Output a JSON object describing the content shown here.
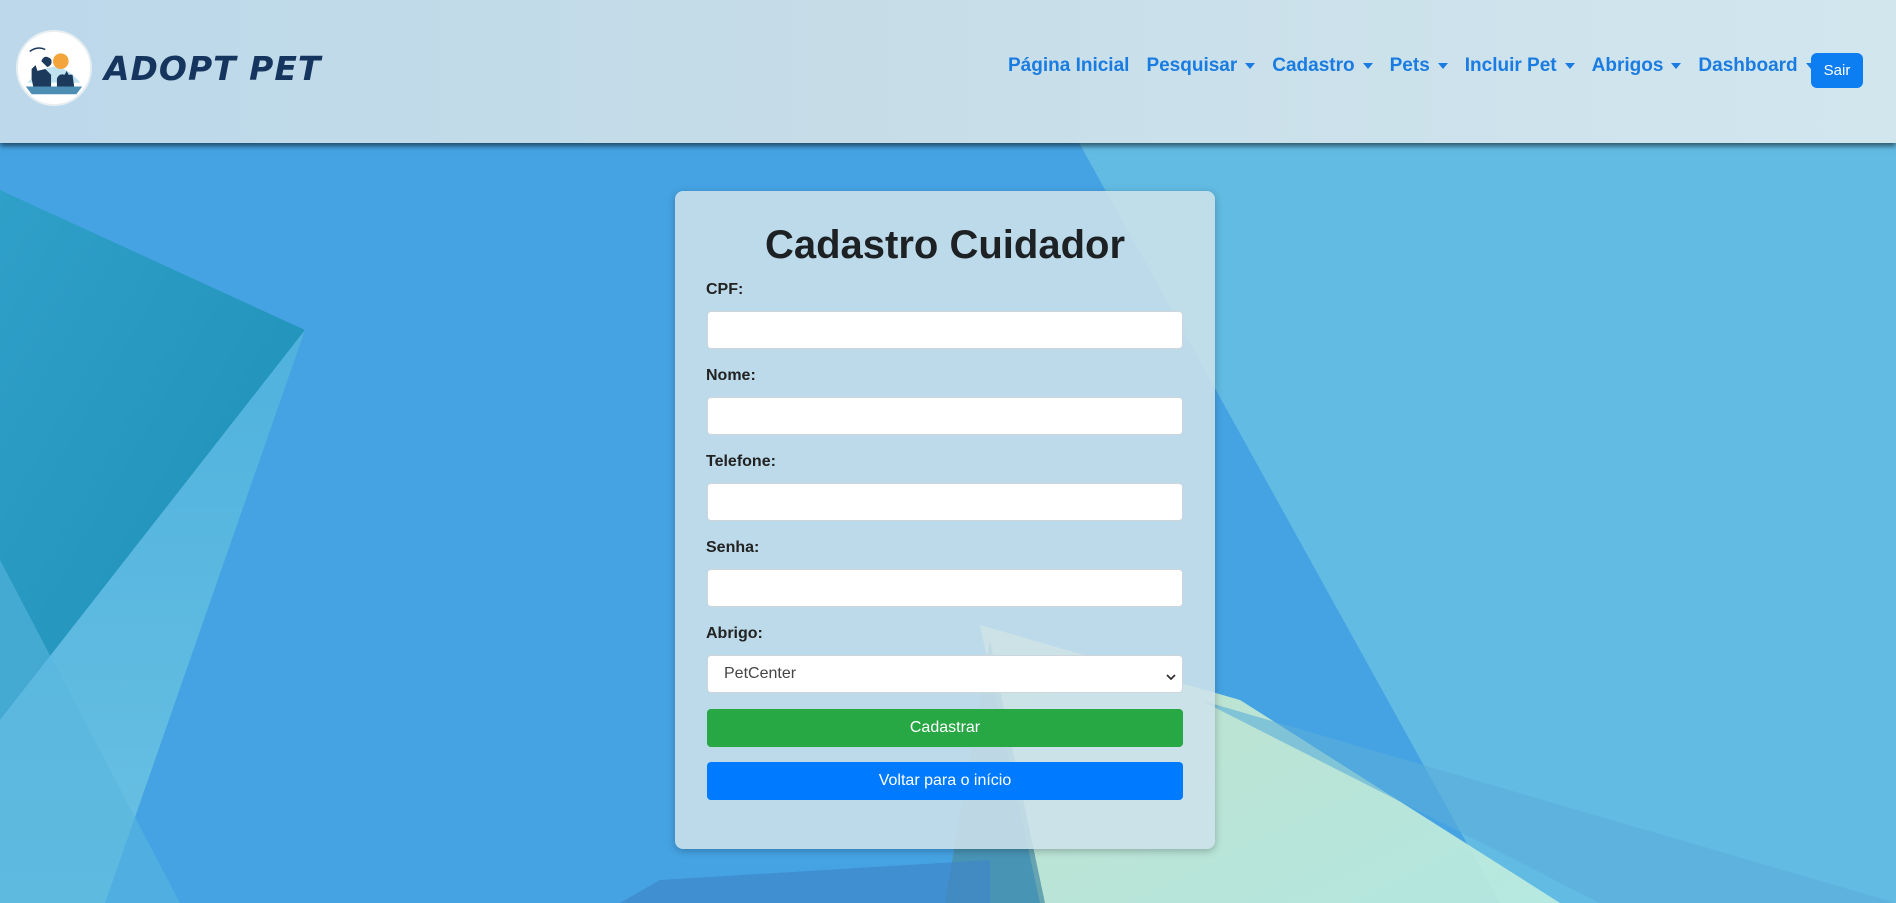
{
  "brand": {
    "name": "ADOPT PET",
    "logo_icon": "dog-cat-logo-icon"
  },
  "nav": {
    "items": [
      {
        "label": "Página Inicial",
        "dropdown": false
      },
      {
        "label": "Pesquisar",
        "dropdown": true
      },
      {
        "label": "Cadastro",
        "dropdown": true
      },
      {
        "label": "Pets",
        "dropdown": true
      },
      {
        "label": "Incluir Pet",
        "dropdown": true
      },
      {
        "label": "Abrigos",
        "dropdown": true
      },
      {
        "label": "Dashboard",
        "dropdown": true
      }
    ],
    "logout_label": "Sair"
  },
  "form": {
    "title": "Cadastro Cuidador",
    "fields": {
      "cpf": {
        "label": "CPF:",
        "value": ""
      },
      "nome": {
        "label": "Nome:",
        "value": ""
      },
      "telefone": {
        "label": "Telefone:",
        "value": ""
      },
      "senha": {
        "label": "Senha:",
        "value": ""
      },
      "abrigo": {
        "label": "Abrigo:",
        "selected": "PetCenter"
      }
    },
    "submit_label": "Cadastrar",
    "back_label": "Voltar para o início"
  },
  "colors": {
    "nav_link": "#1a7ce0",
    "brand_text": "#15355e",
    "primary": "#0d7ef2",
    "success": "#28a745",
    "back_button": "#007bff"
  }
}
